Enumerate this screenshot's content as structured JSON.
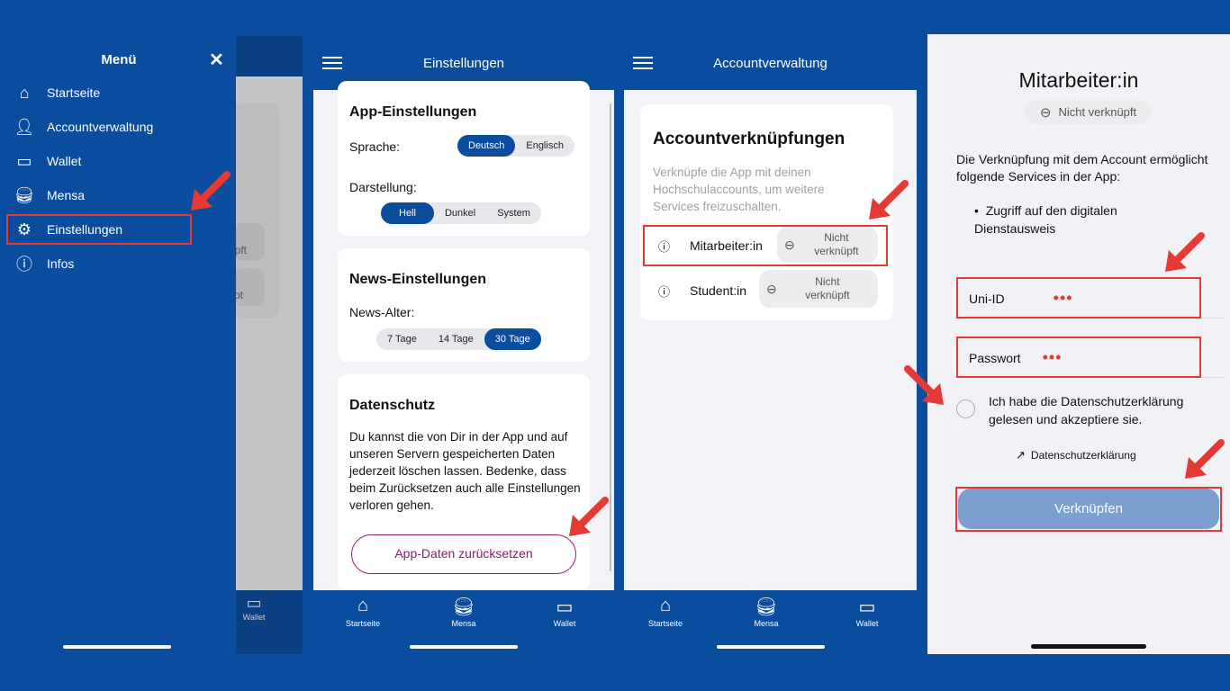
{
  "colors": {
    "brand": "#0a4c9e",
    "highlight": "#e53935",
    "reset_button": "#8e1a6e"
  },
  "panel1": {
    "title": "Menü",
    "close_icon": "close-icon",
    "items": [
      {
        "label": "Startseite",
        "icon": "home-icon"
      },
      {
        "label": "Accountverwaltung",
        "icon": "user-icon"
      },
      {
        "label": "Wallet",
        "icon": "wallet-icon"
      },
      {
        "label": "Mensa",
        "icon": "food-icon"
      },
      {
        "label": "Einstellungen",
        "icon": "gear-icon",
        "highlighted": true
      },
      {
        "label": "Infos",
        "icon": "info-icon"
      }
    ],
    "bg_fragments": [
      "pft",
      "pt"
    ],
    "bg_tab": "Wallet"
  },
  "panel2": {
    "title": "Einstellungen",
    "app": {
      "heading": "App-Einstellungen",
      "language_label": "Sprache:",
      "languages": [
        "Deutsch",
        "Englisch"
      ],
      "language_selected": "Deutsch",
      "theme_label": "Darstellung:",
      "themes": [
        "Hell",
        "Dunkel",
        "System"
      ],
      "theme_selected": "Hell"
    },
    "news": {
      "heading": "News-Einstellungen",
      "age_label": "News-Alter:",
      "ages": [
        "7 Tage",
        "14 Tage",
        "30 Tage"
      ],
      "age_selected": "30 Tage"
    },
    "privacy": {
      "heading": "Datenschutz",
      "text": "Du kannst die von Dir in der App und auf unseren Servern gespeicherten Daten jederzeit löschen lassen. Bedenke, dass beim Zurücksetzen auch alle Einstellungen verloren gehen.",
      "reset_button": "App-Daten zurücksetzen"
    }
  },
  "tabs": [
    {
      "label": "Startseite",
      "icon": "home-icon"
    },
    {
      "label": "Mensa",
      "icon": "food-icon"
    },
    {
      "label": "Wallet",
      "icon": "wallet-icon"
    }
  ],
  "panel3": {
    "title": "Accountverwaltung",
    "heading": "Accountverknüpfungen",
    "description": "Verknüpfe die App mit deinen Hochschulaccounts, um weitere Services freizuschalten.",
    "accounts": [
      {
        "label": "Mitarbeiter:in",
        "status_line1": "Nicht",
        "status_line2": "verknüpft"
      },
      {
        "label": "Student:in",
        "status_line1": "Nicht",
        "status_line2": "verknüpft"
      }
    ]
  },
  "panel4": {
    "title": "Mitarbeiter:in",
    "status": "Nicht verknüpft",
    "intro": "Die Verknüpfung mit dem Account ermöglicht folgende Services in der App:",
    "services": [
      "Zugriff auf den digitalen Dienstausweis"
    ],
    "uid_label": "Uni-ID",
    "uid_value": "•••",
    "password_label": "Passwort",
    "password_value": "•••",
    "consent": "Ich habe die Datenschutzerklärung gelesen und akzeptiere sie.",
    "privacy_link": "Datenschutzerklärung",
    "submit": "Verknüpfen"
  }
}
